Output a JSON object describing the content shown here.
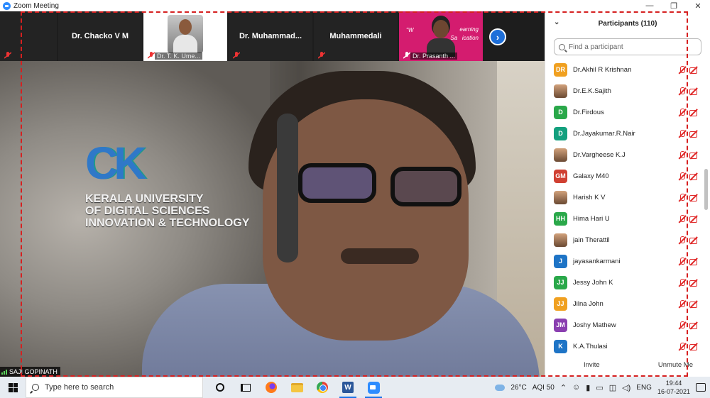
{
  "window": {
    "title": "Zoom Meeting",
    "minimize": "—",
    "restore": "❐",
    "close": "✕"
  },
  "thumbnails": [
    {
      "name": "Dr. Chacko V M",
      "type": "name"
    },
    {
      "name": "Dr. T. K. Ume...",
      "type": "video"
    },
    {
      "name": "Dr.  Muhammad...",
      "type": "name"
    },
    {
      "name": "Muhammedali",
      "type": "name"
    },
    {
      "name": "Dr. Prasanth ...",
      "type": "pink",
      "overlay_left": "\"W",
      "overlay_right": "earning\nSa   ication"
    }
  ],
  "main_video": {
    "speaker": "SAJI GOPINATH",
    "logo_mark": "CK",
    "logo_lines": [
      "KERALA UNIVERSITY",
      "OF DIGITAL SCIENCES",
      "INNOVATION & TECHNOLOGY"
    ]
  },
  "panel": {
    "title": "Participants (110)",
    "search_placeholder": "Find a participant",
    "invite": "Invite",
    "unmute": "Unmute Me",
    "participants": [
      {
        "initials": "DR",
        "name": "Dr.Akhil R Krishnan",
        "color": "#f0a020",
        "photo": false
      },
      {
        "initials": "",
        "name": "Dr.E.K.Sajith",
        "color": "",
        "photo": true
      },
      {
        "initials": "D",
        "name": "Dr.Firdous",
        "color": "#2aa84a",
        "photo": false
      },
      {
        "initials": "D",
        "name": "Dr.Jayakumar.R.Nair",
        "color": "#13a07e",
        "photo": false
      },
      {
        "initials": "",
        "name": "Dr.Vargheese K.J",
        "color": "",
        "photo": true
      },
      {
        "initials": "GM",
        "name": "Galaxy M40",
        "color": "#d04032",
        "photo": false
      },
      {
        "initials": "",
        "name": "Harish K V",
        "color": "",
        "photo": true
      },
      {
        "initials": "HH",
        "name": "Hima Hari U",
        "color": "#2aa84a",
        "photo": false
      },
      {
        "initials": "",
        "name": "jain Therattil",
        "color": "",
        "photo": true
      },
      {
        "initials": "J",
        "name": "jayasankarmani",
        "color": "#1e74c6",
        "photo": false
      },
      {
        "initials": "JJ",
        "name": "Jessy John K",
        "color": "#2aa84a",
        "photo": false
      },
      {
        "initials": "JJ",
        "name": "Jilna John",
        "color": "#f0a020",
        "photo": false
      },
      {
        "initials": "JM",
        "name": "Joshy Mathew",
        "color": "#8a3fb0",
        "photo": false
      },
      {
        "initials": "K",
        "name": "K.A.Thulasi",
        "color": "#1e74c6",
        "photo": false
      }
    ]
  },
  "taskbar": {
    "search_placeholder": "Type here to search",
    "weather": "26°C",
    "aqi": "AQI 50",
    "lang": "ENG",
    "time": "19:44",
    "date": "16-07-2021"
  }
}
